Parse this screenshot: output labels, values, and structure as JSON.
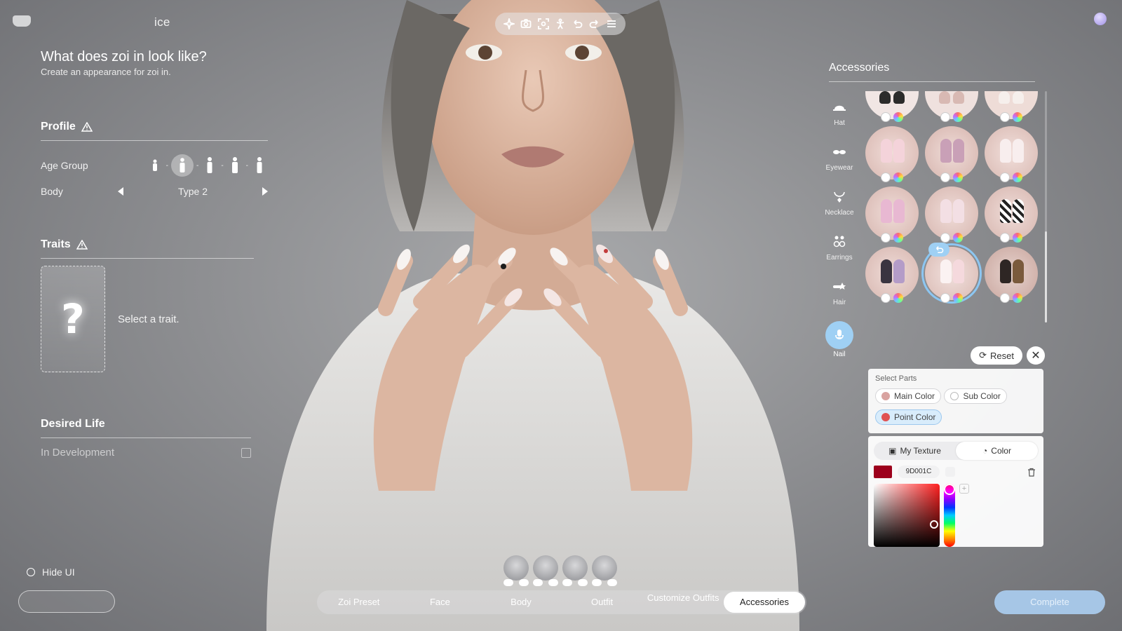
{
  "header": {
    "title_fragment": "ice",
    "toolbar": [
      "sparkle-icon",
      "camera-icon",
      "focus-icon",
      "pose-icon",
      "undo-icon",
      "redo-icon",
      "menu-icon"
    ]
  },
  "left_panel": {
    "question": "What does zoi in look like?",
    "subtitle": "Create an appearance for zoi in.",
    "profile": {
      "heading": "Profile",
      "age_group_label": "Age Group",
      "age_group_selected_index": 1,
      "body_label": "Body",
      "body_value": "Type 2"
    },
    "traits": {
      "heading": "Traits",
      "placeholder": "?",
      "hint": "Select a trait."
    },
    "desired_life": {
      "heading": "Desired Life",
      "status": "In Development"
    },
    "hide_ui_label": "Hide UI"
  },
  "accessories": {
    "title": "Accessories",
    "categories": [
      {
        "label": "Hat",
        "icon": "hat-icon"
      },
      {
        "label": "Eyewear",
        "icon": "eyewear-icon"
      },
      {
        "label": "Necklace",
        "icon": "necklace-icon"
      },
      {
        "label": "Earrings",
        "icon": "earrings-icon"
      },
      {
        "label": "Hair",
        "icon": "hair-clip-icon"
      },
      {
        "label": "Nail",
        "icon": "nail-icon"
      }
    ],
    "active_category": "Nail",
    "selected_item_index": 10,
    "reset_label": "Reset"
  },
  "select_parts": {
    "heading": "Select Parts",
    "options": [
      {
        "label": "Main Color",
        "color": "#d9a3a0"
      },
      {
        "label": "Sub Color",
        "color": "#ffffff"
      },
      {
        "label": "Point Color",
        "color": "#e05252"
      }
    ],
    "selected": "Point Color"
  },
  "color_editor": {
    "tabs": [
      "My Texture",
      "Color"
    ],
    "active_tab": "Color",
    "hex_value": "9D001C",
    "swatch_color": "#9d001c"
  },
  "bottom_tabs": [
    "Zoi Preset",
    "Face",
    "Body",
    "Outfit",
    "Customize Outfits",
    "Accessories"
  ],
  "active_tab": "Accessories",
  "complete_label": "Complete"
}
